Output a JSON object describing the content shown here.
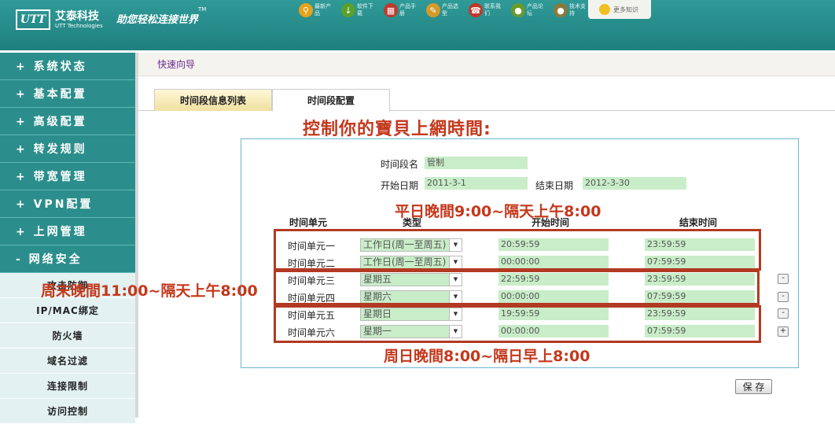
{
  "brand": {
    "logo_text": "UTT",
    "name": "艾泰科技",
    "name_en": "UTT Technologies",
    "slogan": "助您轻松连接世界",
    "tm": "TM"
  },
  "toplinks": [
    {
      "label": "最新产品",
      "icon": "search-icon",
      "color": "#e6a21a"
    },
    {
      "label": "软件下载",
      "icon": "download-icon",
      "color": "#5aa02c"
    },
    {
      "label": "产品手册",
      "icon": "book-icon",
      "color": "#c0392b"
    },
    {
      "label": "产品选型",
      "icon": "clipboard-icon",
      "color": "#d49a2a"
    },
    {
      "label": "联系我们",
      "icon": "phone-icon",
      "color": "#c0392b"
    },
    {
      "label": "产品论坛",
      "icon": "forum-icon",
      "color": "#6a9a2a"
    },
    {
      "label": "技术支持",
      "icon": "support-icon",
      "color": "#8a7a3a"
    }
  ],
  "more": {
    "label": "更多知识"
  },
  "sidebar": {
    "menus": [
      "+ 系统状态",
      "+ 基本配置",
      "+ 高级配置",
      "+ 转发规则",
      "+ 带宽管理",
      "+ VPN配置",
      "+ 上网管理",
      "- 网络安全"
    ],
    "submenus": [
      "攻击防御",
      "IP/MAC绑定",
      "防火墙",
      "域名过滤",
      "连接限制",
      "访问控制"
    ]
  },
  "breadcrumb": "快速向导",
  "tabs": {
    "list": "时间段信息列表",
    "config": "时间段配置"
  },
  "form": {
    "name_label": "时间段名",
    "name_value": "管制",
    "start_label": "开始日期",
    "start_value": "2011-3-1",
    "end_label": "结束日期",
    "end_value": "2012-3-30"
  },
  "columns": {
    "unit": "时间单元",
    "type": "类型",
    "start": "开始时间",
    "end": "结束时间"
  },
  "rows": [
    {
      "unit": "时间单元一",
      "type": "工作日(周一至周五)",
      "start": "20:59:59",
      "end": "23:59:59"
    },
    {
      "unit": "时间单元二",
      "type": "工作日(周一至周五)",
      "start": "00:00:00",
      "end": "07:59:59"
    },
    {
      "unit": "时间单元三",
      "type": "星期五",
      "start": "22:59:59",
      "end": "23:59:59"
    },
    {
      "unit": "时间单元四",
      "type": "星期六",
      "start": "00:00:00",
      "end": "07:59:59"
    },
    {
      "unit": "时间单元五",
      "type": "星期日",
      "start": "19:59:59",
      "end": "23:59:59"
    },
    {
      "unit": "时间单元六",
      "type": "星期一",
      "start": "00:00:00",
      "end": "07:59:59"
    }
  ],
  "row_buttons": [
    "-",
    "-",
    "-",
    "+"
  ],
  "annotations": {
    "title": "控制你的寶貝上網時間:",
    "weekday": "平日晚間9:00~隔天上午8:00",
    "weekend": "周末晚間11:00~隔天上午8:00",
    "sunday": "周日晚間8:00~隔日早上8:00",
    "color": "#c4381c"
  },
  "save_label": "保 存"
}
